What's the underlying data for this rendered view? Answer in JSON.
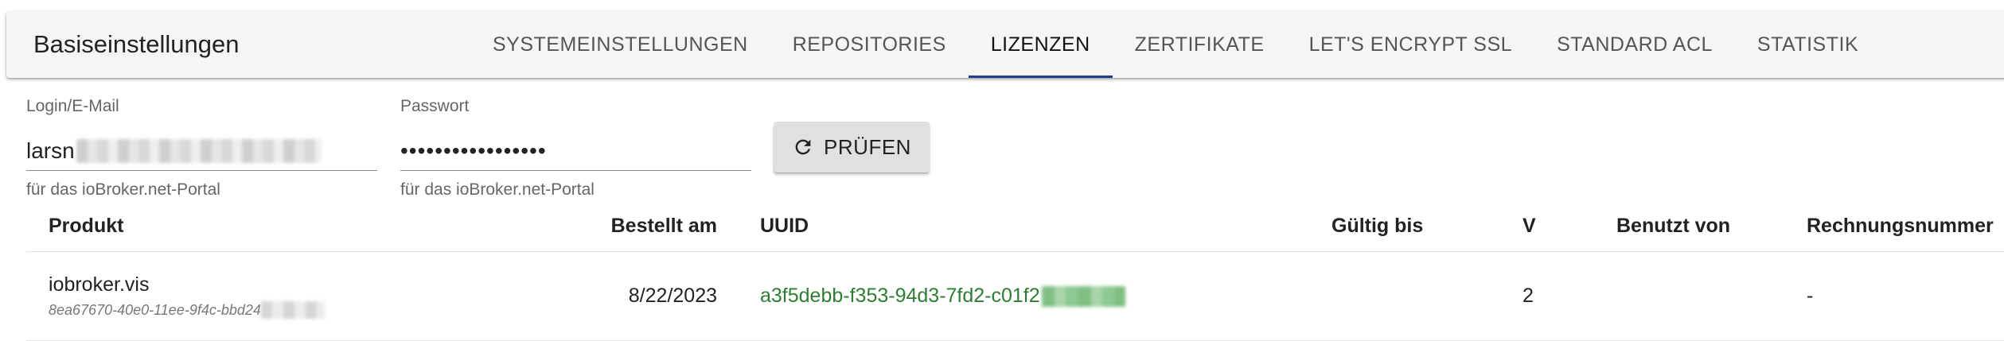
{
  "header": {
    "title": "Basiseinstellungen",
    "tabs": [
      {
        "label": "SYSTEMEINSTELLUNGEN"
      },
      {
        "label": "REPOSITORIES"
      },
      {
        "label": "LIZENZEN"
      },
      {
        "label": "ZERTIFIKATE"
      },
      {
        "label": "LET'S ENCRYPT SSL"
      },
      {
        "label": "STANDARD ACL"
      },
      {
        "label": "STATISTIK"
      }
    ],
    "active_tab": "LIZENZEN",
    "accent_color": "#1f3f8a"
  },
  "form": {
    "login": {
      "label": "Login/E-Mail",
      "value": "larsn",
      "helper": "für das ioBroker.net-Portal"
    },
    "password": {
      "label": "Passwort",
      "value": "•••••••••••••••••",
      "helper": "für das ioBroker.net-Portal"
    },
    "check_button": {
      "label": "PRÜFEN",
      "icon": "refresh-icon"
    }
  },
  "table": {
    "columns": [
      "Produkt",
      "Bestellt am",
      "UUID",
      "Gültig bis",
      "V",
      "Benutzt von",
      "Rechnungsnummer"
    ],
    "rows": [
      {
        "product": "iobroker.vis",
        "product_id": "8ea67670-40e0-11ee-9f4c-bbd24",
        "ordered": "8/22/2023",
        "uuid": "a3f5debb-f353-94d3-7fd2-c01f2",
        "valid_until": "",
        "version": "2",
        "used_by": "",
        "invoice": "-"
      }
    ],
    "uuid_color": "#2e7d32"
  }
}
